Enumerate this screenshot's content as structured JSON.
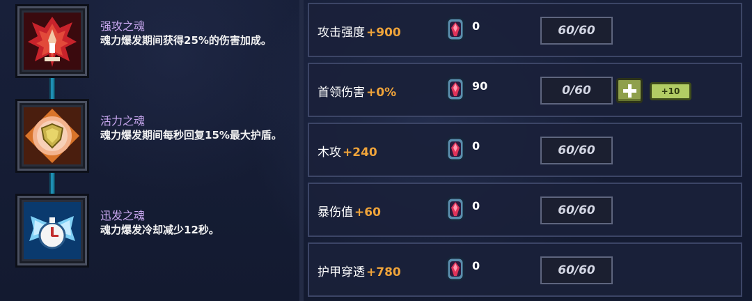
{
  "souls": [
    {
      "name": "强攻之魂",
      "description": "魂力爆发期间获得25%的伤害加成。",
      "icon": "red-crest-icon"
    },
    {
      "name": "活力之魂",
      "description": "魂力爆发期间每秒回复15%最大护盾。",
      "icon": "shield-orb-icon"
    },
    {
      "name": "迅发之魂",
      "description": "魂力爆发冷却减少12秒。",
      "icon": "winged-clock-icon"
    }
  ],
  "stats": [
    {
      "label": "攻击强度",
      "bonus": "+900",
      "gem_count": "0",
      "progress": "60/60"
    },
    {
      "label": "首领伤害",
      "bonus": "+0%",
      "gem_count": "90",
      "progress": "0/60",
      "plus_label": "+10"
    },
    {
      "label": "木攻",
      "bonus": "+240",
      "gem_count": "0",
      "progress": "60/60"
    },
    {
      "label": "暴伤值",
      "bonus": "+60",
      "gem_count": "0",
      "progress": "60/60"
    },
    {
      "label": "护甲穿透",
      "bonus": "+780",
      "gem_count": "0",
      "progress": "60/60"
    }
  ],
  "colors": {
    "soul_name": "#c9a8f0",
    "bonus": "#f0a43a",
    "connector": "#1e8fb3",
    "plus_button": "#8fa04c"
  }
}
